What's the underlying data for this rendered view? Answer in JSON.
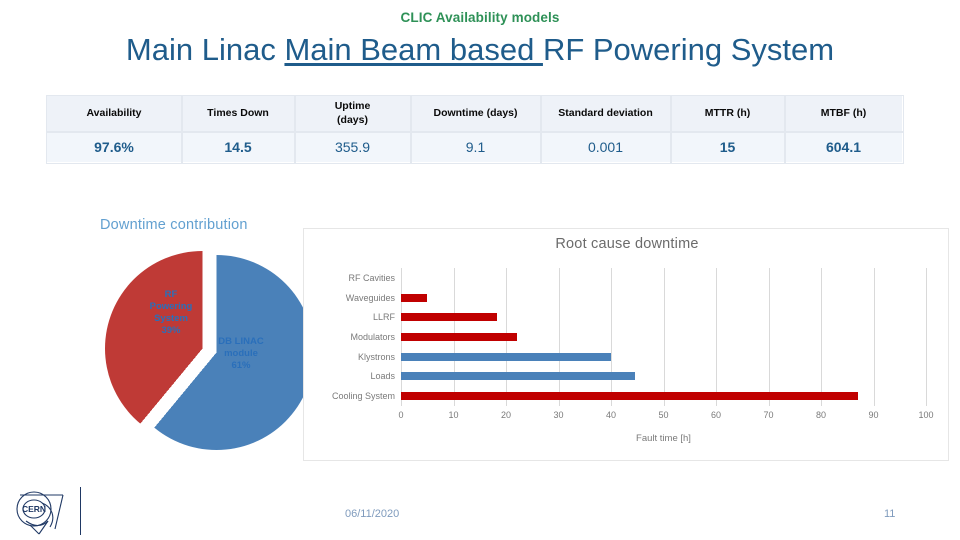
{
  "header": {
    "subtitle": "CLIC Availability models",
    "title_part1": "Main Linac ",
    "title_underlined": "Main Beam based ",
    "title_part2": "RF Powering System",
    "subtitle_color": "#2e9157",
    "title_color": "#1f5c8b"
  },
  "stats_table": {
    "columns": [
      "Availability",
      "Times Down",
      "Uptime\n(days)",
      "Downtime (days)",
      "Standard deviation",
      "MTTR (h)",
      "MTBF (h)"
    ],
    "col_uptime_line1": "Uptime",
    "col_uptime_line2": "(days)",
    "values": [
      "97.6%",
      "14.5",
      "355.9",
      "9.1",
      "0.001",
      "15",
      "604.1"
    ],
    "bold_flags": [
      true,
      true,
      false,
      false,
      false,
      true,
      true
    ],
    "header_bg": "#eef2f8",
    "value_bg": "#f2f6fb",
    "value_color": "#1f5c8b"
  },
  "pie_chart": {
    "title": "Downtime contribution",
    "title_color": "#62a0d0",
    "slices": [
      {
        "label": "RF Powering System",
        "label_line1": "RF",
        "label_line2": "Powering",
        "label_line3": "System",
        "percent": "39%",
        "value": 39,
        "color": "#bf3a36",
        "exploded": true
      },
      {
        "label": "DB LINAC module",
        "label_line1": "DB LINAC",
        "label_line2": "module",
        "percent": "61%",
        "value": 61,
        "color": "#4a81b9",
        "exploded": false
      }
    ]
  },
  "chart_data": {
    "type": "bar",
    "orientation": "horizontal",
    "title": "Root cause downtime",
    "xlabel": "Fault time [h]",
    "ylabel": "",
    "categories": [
      "RF Cavities",
      "Waveguides",
      "LLRF",
      "Modulators",
      "Klystrons",
      "Loads",
      "Cooling System"
    ],
    "values": [
      0,
      5,
      18.2,
      22,
      40,
      44.5,
      87
    ],
    "bar_colors": [
      "#c00000",
      "#c00000",
      "#c00000",
      "#c00000",
      "#4a81b9",
      "#4a81b9",
      "#c00000"
    ],
    "xlim": [
      0,
      100
    ],
    "xticks": [
      0,
      10,
      20,
      30,
      40,
      50,
      60,
      70,
      80,
      90,
      100
    ],
    "xtick_labels": [
      "0",
      "10",
      "20",
      "30",
      "40",
      "50",
      "60",
      "70",
      "80",
      "90",
      "100"
    ],
    "grid": true,
    "legend": false
  },
  "footer": {
    "logo_text": "CERN",
    "date": "06/11/2020",
    "page_number": "11",
    "text_color": "#7f9bbd"
  }
}
